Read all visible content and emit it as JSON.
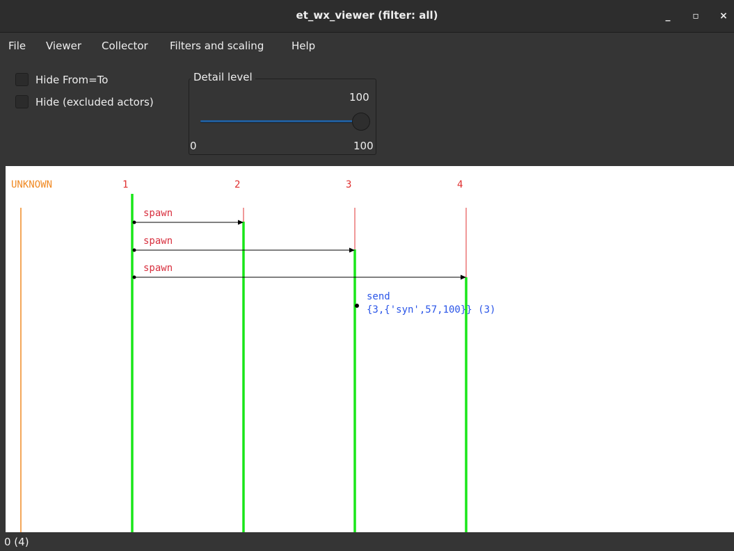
{
  "window": {
    "title": "et_wx_viewer (filter: all)",
    "minimize": "_",
    "maximize": "▫",
    "close": "×"
  },
  "menu": [
    "File",
    "Viewer",
    "Collector",
    "Filters and scaling",
    "Help"
  ],
  "options": {
    "hide_from_to": "Hide From=To",
    "hide_excluded": "Hide (excluded actors)",
    "hide_from_to_checked": false,
    "hide_excluded_checked": false
  },
  "detail": {
    "label": "Detail level",
    "value": "100",
    "min": "0",
    "max": "100",
    "fraction": 1.0
  },
  "actors": [
    {
      "name": "UNKNOWN",
      "color": "#f08a24"
    },
    {
      "name": "1",
      "color": "#e03030"
    },
    {
      "name": "2",
      "color": "#e03030"
    },
    {
      "name": "3",
      "color": "#e03030"
    },
    {
      "name": "4",
      "color": "#e03030"
    }
  ],
  "events": [
    {
      "label": "spawn",
      "from": "1",
      "to": "2"
    },
    {
      "label": "spawn",
      "from": "1",
      "to": "3"
    },
    {
      "label": "spawn",
      "from": "1",
      "to": "4"
    },
    {
      "label": "send",
      "detail": "{3,{'syn',57,100}} (3)",
      "from": "3"
    }
  ],
  "colors": {
    "alive": "#19e619",
    "spawn_text": "#d8303f",
    "send_text": "#2a55e8",
    "arrow": "#000000"
  },
  "status": "0 (4)"
}
